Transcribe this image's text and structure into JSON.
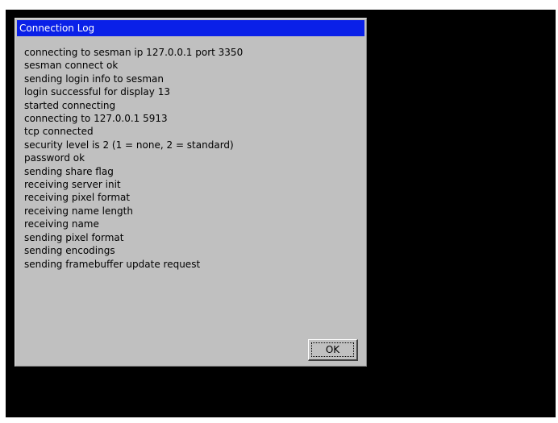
{
  "colors": {
    "screen_background": "#000000",
    "dialog_background": "#c0c0c0",
    "titlebar_background": "#0a20e8",
    "titlebar_text": "#ffffff"
  },
  "dialog": {
    "title": "Connection Log",
    "log_lines": [
      "connecting to sesman ip 127.0.0.1 port 3350",
      "sesman connect ok",
      "sending login info to sesman",
      "login successful for display 13",
      "started connecting",
      "connecting to 127.0.0.1 5913",
      "tcp connected",
      "security level is 2 (1 = none, 2 = standard)",
      "password ok",
      "sending share flag",
      "receiving server init",
      "receiving pixel format",
      "receiving name length",
      "receiving name",
      "sending pixel format",
      "sending encodings",
      "sending framebuffer update request"
    ],
    "ok_label": "OK"
  }
}
